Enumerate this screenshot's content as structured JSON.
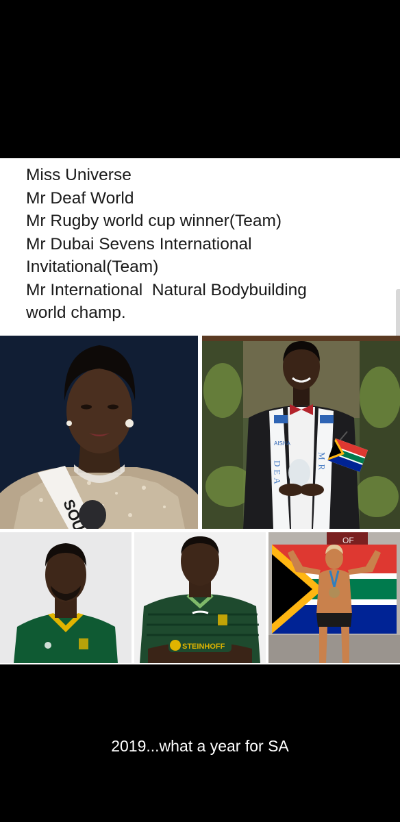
{
  "post": {
    "lines": [
      "Miss Universe",
      "Mr Deaf World",
      "Mr Rugby world cup winner(Team)",
      "Mr Dubai Sevens International",
      "Invitational(Team)",
      "Mr International  Natural Bodybuilding",
      "world champ."
    ]
  },
  "photos": {
    "miss_universe": {
      "sash_text": "SOU"
    },
    "deaf_world": {
      "sash_letters": "DEA",
      "sash_letters_right": "MR",
      "sash_logo_text": "AISHA"
    },
    "rugby_captain": {},
    "sevens_player": {
      "sponsor_text": "STEINHOFF"
    },
    "bodybuilder": {
      "banner_text": "OF"
    }
  },
  "caption": "2019...what a year for SA",
  "colors": {
    "background": "#000000",
    "card": "#ffffff",
    "springbok_green": "#0f5a33",
    "springbok_gold": "#e0b400",
    "sa_flag": [
      "#de3831",
      "#002395",
      "#007a4d",
      "#ffb612",
      "#000000",
      "#ffffff"
    ]
  }
}
